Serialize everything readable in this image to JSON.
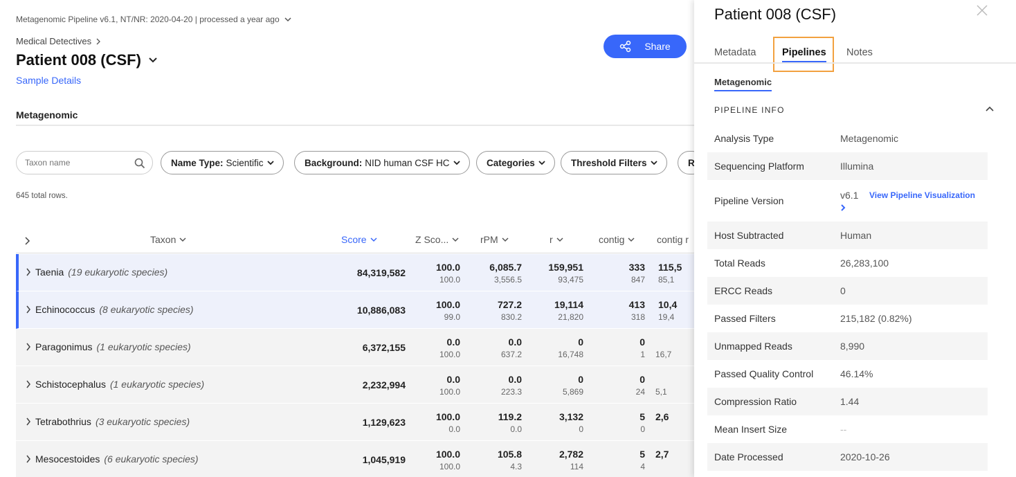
{
  "header": {
    "pipeline_info": "Metagenomic Pipeline v6.1, NT/NR: 2020-04-20 | processed a year ago",
    "breadcrumb": "Medical Detectives",
    "sample_name": "Patient 008 (CSF)",
    "sample_details_link": "Sample Details",
    "share_label": "Share"
  },
  "main_tab": "Metagenomic",
  "filters": {
    "search_placeholder": "Taxon name",
    "name_type_label": "Name Type:",
    "name_type_value": "Scientific",
    "background_label": "Background:",
    "background_value": "NID human CSF HC",
    "categories_label": "Categories",
    "threshold_label": "Threshold Filters",
    "more_label": "R"
  },
  "total_rows": "645 total rows.",
  "table": {
    "columns": {
      "taxon": "Taxon",
      "score": "Score",
      "zscore": "Z Sco...",
      "rpm": "rPM",
      "r": "r",
      "contig": "contig",
      "contig_r": "contig r"
    },
    "rows": [
      {
        "name": "Taenia",
        "meta": "(19 eukaryotic species)",
        "score": "84,319,582",
        "z_top": "100.0",
        "z_bot": "100.0",
        "rpm_top": "6,085.7",
        "rpm_bot": "3,556.5",
        "r_top": "159,951",
        "r_bot": "93,475",
        "c_top": "333",
        "c_bot": "847",
        "cr_top": "115,5",
        "cr_bot": "85,1"
      },
      {
        "name": "Echinococcus",
        "meta": "(8 eukaryotic species)",
        "score": "10,886,083",
        "z_top": "100.0",
        "z_bot": "99.0",
        "rpm_top": "727.2",
        "rpm_bot": "830.2",
        "r_top": "19,114",
        "r_bot": "21,820",
        "c_top": "413",
        "c_bot": "318",
        "cr_top": "10,4",
        "cr_bot": "19,4"
      },
      {
        "name": "Paragonimus",
        "meta": "(1 eukaryotic species)",
        "score": "6,372,155",
        "z_top": "0.0",
        "z_bot": "100.0",
        "rpm_top": "0.0",
        "rpm_bot": "637.2",
        "r_top": "0",
        "r_bot": "16,748",
        "c_top": "0",
        "c_bot": "1",
        "cr_top": "",
        "cr_bot": "16,7"
      },
      {
        "name": "Schistocephalus",
        "meta": "(1 eukaryotic species)",
        "score": "2,232,994",
        "z_top": "0.0",
        "z_bot": "100.0",
        "rpm_top": "0.0",
        "rpm_bot": "223.3",
        "r_top": "0",
        "r_bot": "5,869",
        "c_top": "0",
        "c_bot": "24",
        "cr_top": "",
        "cr_bot": "5,1"
      },
      {
        "name": "Tetrabothrius",
        "meta": "(3 eukaryotic species)",
        "score": "1,129,623",
        "z_top": "100.0",
        "z_bot": "0.0",
        "rpm_top": "119.2",
        "rpm_bot": "0.0",
        "r_top": "3,132",
        "r_bot": "0",
        "c_top": "5",
        "c_bot": "0",
        "cr_top": "2,6",
        "cr_bot": ""
      },
      {
        "name": "Mesocestoides",
        "meta": "(6 eukaryotic species)",
        "score": "1,045,919",
        "z_top": "100.0",
        "z_bot": "100.0",
        "rpm_top": "105.8",
        "rpm_bot": "4.3",
        "r_top": "2,782",
        "r_bot": "114",
        "c_top": "5",
        "c_bot": "4",
        "cr_top": "2,7",
        "cr_bot": ""
      }
    ]
  },
  "panel": {
    "title": "Patient 008 (CSF)",
    "tabs": [
      "Metadata",
      "Pipelines",
      "Notes"
    ],
    "active_tab": "Pipelines",
    "sub_tab": "Metagenomic",
    "section_title": "PIPELINE INFO",
    "info": [
      {
        "label": "Analysis Type",
        "value": "Metagenomic"
      },
      {
        "label": "Sequencing Platform",
        "value": "Illumina"
      },
      {
        "label": "Pipeline Version",
        "value": "v6.1",
        "link": "View Pipeline Visualization"
      },
      {
        "label": "Host Subtracted",
        "value": "Human"
      },
      {
        "label": "Total Reads",
        "value": "26,283,100"
      },
      {
        "label": "ERCC Reads",
        "value": "0"
      },
      {
        "label": "Passed Filters",
        "value": "215,182 (0.82%)"
      },
      {
        "label": "Unmapped Reads",
        "value": "8,990"
      },
      {
        "label": "Passed Quality Control",
        "value": "46.14%"
      },
      {
        "label": "Compression Ratio",
        "value": "1.44"
      },
      {
        "label": "Mean Insert Size",
        "value": "--"
      },
      {
        "label": "Date Processed",
        "value": "2020-10-26"
      }
    ]
  },
  "colors": {
    "accent": "#3867fa",
    "highlight": "#f2a13f",
    "selected_row": "#eef1fb"
  }
}
